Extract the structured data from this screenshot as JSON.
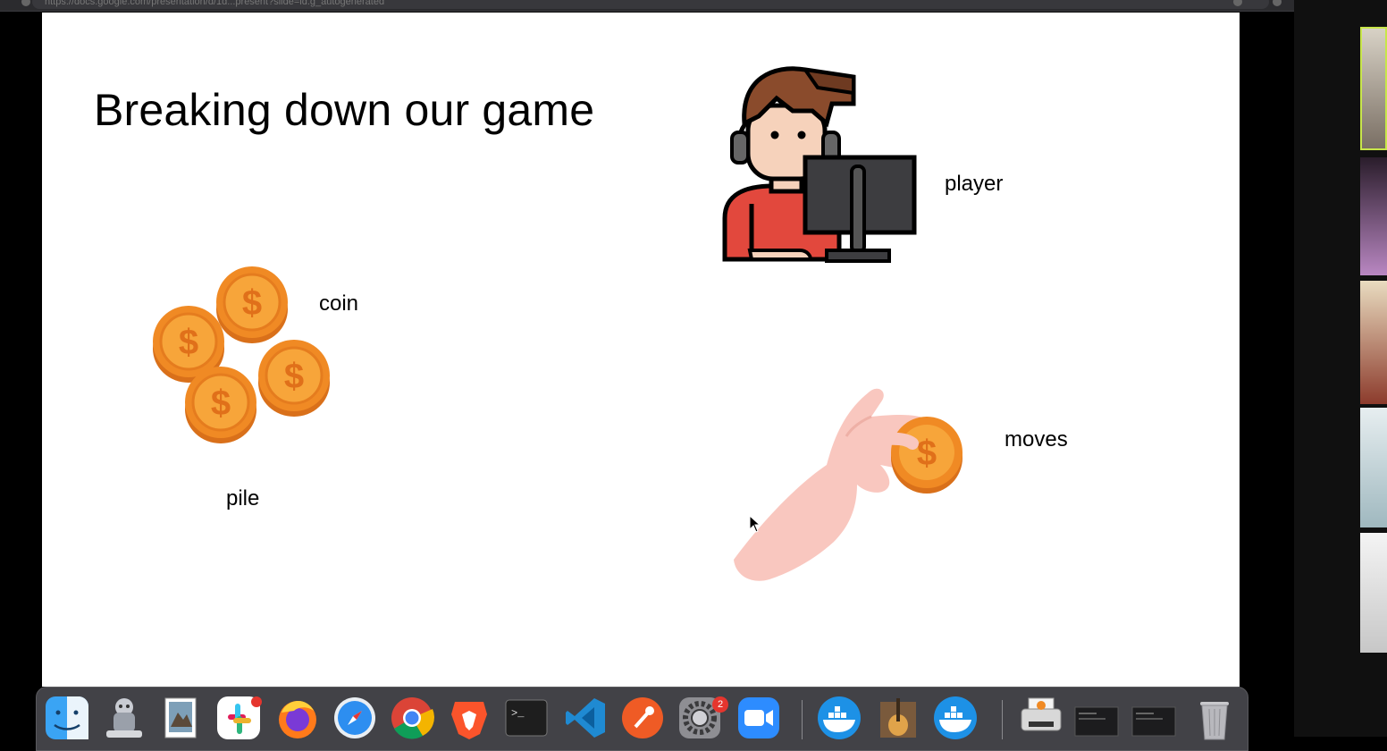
{
  "browser": {
    "url": "https://docs.google.com/presentation/d/1d...present?slide=id.g_autogenerated"
  },
  "slide": {
    "title": "Breaking down our game",
    "labels": {
      "player": "player",
      "coin": "coin",
      "pile": "pile",
      "moves": "moves"
    }
  },
  "dock": {
    "items": [
      {
        "name": "Finder",
        "icon": "finder-icon"
      },
      {
        "name": "Automator",
        "icon": "automator-icon"
      },
      {
        "name": "Preview",
        "icon": "preview-icon"
      },
      {
        "name": "Slack",
        "icon": "slack-icon"
      },
      {
        "name": "Firefox",
        "icon": "firefox-icon"
      },
      {
        "name": "Safari",
        "icon": "safari-icon"
      },
      {
        "name": "Chrome",
        "icon": "chrome-icon"
      },
      {
        "name": "Brave",
        "icon": "brave-icon"
      },
      {
        "name": "Terminal",
        "icon": "terminal-icon"
      },
      {
        "name": "Visual Studio Code",
        "icon": "vscode-icon"
      },
      {
        "name": "Postman",
        "icon": "postman-icon"
      },
      {
        "name": "System Preferences",
        "icon": "system-preferences-icon"
      },
      {
        "name": "Zoom",
        "icon": "zoom-icon"
      },
      {
        "name": "Docker",
        "icon": "docker-icon"
      },
      {
        "name": "GarageBand",
        "icon": "garageband-icon"
      },
      {
        "name": "Docker",
        "icon": "docker-icon"
      },
      {
        "name": "Printer",
        "icon": "printer-icon"
      },
      {
        "name": "Terminal window",
        "icon": "window-thumbnail-icon"
      },
      {
        "name": "Terminal window",
        "icon": "window-thumbnail-icon"
      },
      {
        "name": "Trash",
        "icon": "trash-icon"
      }
    ],
    "slack_badge": "",
    "sysprefs_badge": "2"
  },
  "colors": {
    "coin_orange": "#f08a24",
    "coin_light": "#f7b24a",
    "player_shirt": "#e2483d",
    "player_hair": "#8a4b2c",
    "hand": "#f9c7bf",
    "slide_bg": "#ffffff"
  }
}
